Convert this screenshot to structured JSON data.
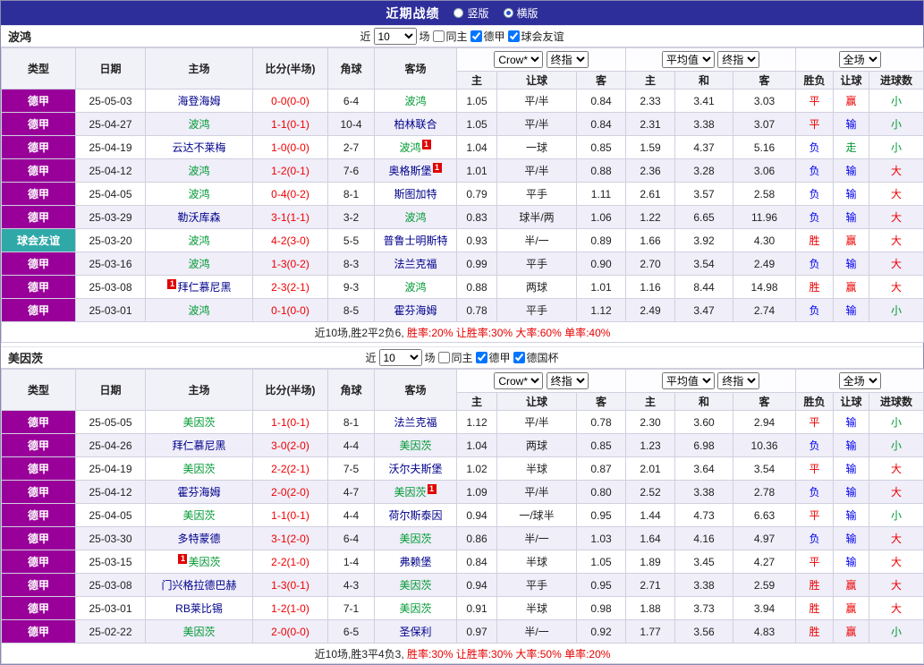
{
  "header": {
    "title": "近期战绩",
    "bar_color": "#2E2E9B",
    "options": [
      {
        "label": "竖版",
        "selected": false
      },
      {
        "label": "横版",
        "selected": true
      }
    ]
  },
  "filter_bar": {
    "near": "近",
    "count": "10",
    "games": "场"
  },
  "columns": [
    "类型",
    "日期",
    "主场",
    "比分(半场)",
    "角球",
    "客场",
    "主",
    "让球",
    "客",
    "主",
    "和",
    "客",
    "胜负",
    "让球",
    "进球数"
  ],
  "dropdowns": {
    "asian": [
      "Crow*",
      "终指"
    ],
    "euro": [
      "平均值",
      "终指"
    ],
    "scope": [
      "全场"
    ]
  },
  "type_colors": {
    "德甲": "#990099",
    "球会友谊": "#2FA8A8"
  },
  "result_colors": {
    "胜": "#EE0000",
    "平": "#EE0000",
    "负": "#0000EE",
    "赢": "#EE0000",
    "输": "#0000EE",
    "走": "#009933",
    "大": "#EE0000",
    "小": "#009933"
  },
  "team_colors": {
    "self": "#009933",
    "opponent": "#00008B"
  },
  "score_color": "#EE0000",
  "tables": [
    {
      "team": "波鸿",
      "filters": [
        {
          "label": "同主",
          "checked": false
        },
        {
          "label": "德甲",
          "checked": true
        },
        {
          "label": "球会友谊",
          "checked": true
        }
      ],
      "rows": [
        {
          "type": "德甲",
          "date": "25-05-03",
          "home": {
            "name": "海登海姆",
            "self": false
          },
          "score": "0-0(0-0)",
          "corners": "6-4",
          "away": {
            "name": "波鸿",
            "self": true
          },
          "asian": [
            "1.05",
            "平/半",
            "0.84"
          ],
          "euro": [
            "2.33",
            "3.41",
            "3.03"
          ],
          "results": [
            "平",
            "赢",
            "小"
          ]
        },
        {
          "type": "德甲",
          "date": "25-04-27",
          "home": {
            "name": "波鸿",
            "self": true
          },
          "score": "1-1(0-1)",
          "corners": "10-4",
          "away": {
            "name": "柏林联合",
            "self": false
          },
          "asian": [
            "1.05",
            "平/半",
            "0.84"
          ],
          "euro": [
            "2.31",
            "3.38",
            "3.07"
          ],
          "results": [
            "平",
            "输",
            "小"
          ]
        },
        {
          "type": "德甲",
          "date": "25-04-19",
          "home": {
            "name": "云达不莱梅",
            "self": false
          },
          "score": "1-0(0-0)",
          "corners": "2-7",
          "away": {
            "name": "波鸿",
            "self": true,
            "card": "1",
            "card_pos": "right"
          },
          "asian": [
            "1.04",
            "一球",
            "0.85"
          ],
          "euro": [
            "1.59",
            "4.37",
            "5.16"
          ],
          "results": [
            "负",
            "走",
            "小"
          ]
        },
        {
          "type": "德甲",
          "date": "25-04-12",
          "home": {
            "name": "波鸿",
            "self": true
          },
          "score": "1-2(0-1)",
          "corners": "7-6",
          "away": {
            "name": "奥格斯堡",
            "self": false,
            "card": "1",
            "card_pos": "right"
          },
          "asian": [
            "1.01",
            "平/半",
            "0.88"
          ],
          "euro": [
            "2.36",
            "3.28",
            "3.06"
          ],
          "results": [
            "负",
            "输",
            "大"
          ]
        },
        {
          "type": "德甲",
          "date": "25-04-05",
          "home": {
            "name": "波鸿",
            "self": true
          },
          "score": "0-4(0-2)",
          "corners": "8-1",
          "away": {
            "name": "斯图加特",
            "self": false
          },
          "asian": [
            "0.79",
            "平手",
            "1.11"
          ],
          "euro": [
            "2.61",
            "3.57",
            "2.58"
          ],
          "results": [
            "负",
            "输",
            "大"
          ]
        },
        {
          "type": "德甲",
          "date": "25-03-29",
          "home": {
            "name": "勒沃库森",
            "self": false
          },
          "score": "3-1(1-1)",
          "corners": "3-2",
          "away": {
            "name": "波鸿",
            "self": true
          },
          "asian": [
            "0.83",
            "球半/两",
            "1.06"
          ],
          "euro": [
            "1.22",
            "6.65",
            "11.96"
          ],
          "results": [
            "负",
            "输",
            "大"
          ]
        },
        {
          "type": "球会友谊",
          "date": "25-03-20",
          "home": {
            "name": "波鸿",
            "self": true
          },
          "score": "4-2(3-0)",
          "corners": "5-5",
          "away": {
            "name": "普鲁士明斯特",
            "self": false
          },
          "asian": [
            "0.93",
            "半/一",
            "0.89"
          ],
          "euro": [
            "1.66",
            "3.92",
            "4.30"
          ],
          "results": [
            "胜",
            "赢",
            "大"
          ]
        },
        {
          "type": "德甲",
          "date": "25-03-16",
          "home": {
            "name": "波鸿",
            "self": true
          },
          "score": "1-3(0-2)",
          "corners": "8-3",
          "away": {
            "name": "法兰克福",
            "self": false
          },
          "asian": [
            "0.99",
            "平手",
            "0.90"
          ],
          "euro": [
            "2.70",
            "3.54",
            "2.49"
          ],
          "results": [
            "负",
            "输",
            "大"
          ]
        },
        {
          "type": "德甲",
          "date": "25-03-08",
          "home": {
            "name": "拜仁慕尼黑",
            "self": false,
            "card": "1",
            "card_pos": "left"
          },
          "score": "2-3(2-1)",
          "corners": "9-3",
          "away": {
            "name": "波鸿",
            "self": true
          },
          "asian": [
            "0.88",
            "两球",
            "1.01"
          ],
          "euro": [
            "1.16",
            "8.44",
            "14.98"
          ],
          "results": [
            "胜",
            "赢",
            "大"
          ]
        },
        {
          "type": "德甲",
          "date": "25-03-01",
          "home": {
            "name": "波鸿",
            "self": true
          },
          "score": "0-1(0-0)",
          "corners": "8-5",
          "away": {
            "name": "霍芬海姆",
            "self": false
          },
          "asian": [
            "0.78",
            "平手",
            "1.12"
          ],
          "euro": [
            "2.49",
            "3.47",
            "2.74"
          ],
          "results": [
            "负",
            "输",
            "小"
          ]
        }
      ],
      "summary": {
        "prefix": "近10场,胜2平2负6, ",
        "stats": "胜率:20% 让胜率:30% 大率:60% 单率:40%"
      }
    },
    {
      "team": "美因茨",
      "filters": [
        {
          "label": "同主",
          "checked": false
        },
        {
          "label": "德甲",
          "checked": true
        },
        {
          "label": "德国杯",
          "checked": true
        }
      ],
      "rows": [
        {
          "type": "德甲",
          "date": "25-05-05",
          "home": {
            "name": "美因茨",
            "self": true
          },
          "score": "1-1(0-1)",
          "corners": "8-1",
          "away": {
            "name": "法兰克福",
            "self": false
          },
          "asian": [
            "1.12",
            "平/半",
            "0.78"
          ],
          "euro": [
            "2.30",
            "3.60",
            "2.94"
          ],
          "results": [
            "平",
            "输",
            "小"
          ]
        },
        {
          "type": "德甲",
          "date": "25-04-26",
          "home": {
            "name": "拜仁慕尼黑",
            "self": false
          },
          "score": "3-0(2-0)",
          "corners": "4-4",
          "away": {
            "name": "美因茨",
            "self": true
          },
          "asian": [
            "1.04",
            "两球",
            "0.85"
          ],
          "euro": [
            "1.23",
            "6.98",
            "10.36"
          ],
          "results": [
            "负",
            "输",
            "小"
          ]
        },
        {
          "type": "德甲",
          "date": "25-04-19",
          "home": {
            "name": "美因茨",
            "self": true
          },
          "score": "2-2(2-1)",
          "corners": "7-5",
          "away": {
            "name": "沃尔夫斯堡",
            "self": false
          },
          "asian": [
            "1.02",
            "半球",
            "0.87"
          ],
          "euro": [
            "2.01",
            "3.64",
            "3.54"
          ],
          "results": [
            "平",
            "输",
            "大"
          ]
        },
        {
          "type": "德甲",
          "date": "25-04-12",
          "home": {
            "name": "霍芬海姆",
            "self": false
          },
          "score": "2-0(2-0)",
          "corners": "4-7",
          "away": {
            "name": "美因茨",
            "self": true,
            "card": "1",
            "card_pos": "right"
          },
          "asian": [
            "1.09",
            "平/半",
            "0.80"
          ],
          "euro": [
            "2.52",
            "3.38",
            "2.78"
          ],
          "results": [
            "负",
            "输",
            "大"
          ]
        },
        {
          "type": "德甲",
          "date": "25-04-05",
          "home": {
            "name": "美因茨",
            "self": true
          },
          "score": "1-1(0-1)",
          "corners": "4-4",
          "away": {
            "name": "荷尔斯泰因",
            "self": false
          },
          "asian": [
            "0.94",
            "一/球半",
            "0.95"
          ],
          "euro": [
            "1.44",
            "4.73",
            "6.63"
          ],
          "results": [
            "平",
            "输",
            "小"
          ]
        },
        {
          "type": "德甲",
          "date": "25-03-30",
          "home": {
            "name": "多特蒙德",
            "self": false
          },
          "score": "3-1(2-0)",
          "corners": "6-4",
          "away": {
            "name": "美因茨",
            "self": true
          },
          "asian": [
            "0.86",
            "半/一",
            "1.03"
          ],
          "euro": [
            "1.64",
            "4.16",
            "4.97"
          ],
          "results": [
            "负",
            "输",
            "大"
          ]
        },
        {
          "type": "德甲",
          "date": "25-03-15",
          "home": {
            "name": "美因茨",
            "self": true,
            "card": "1",
            "card_pos": "left"
          },
          "score": "2-2(1-0)",
          "corners": "1-4",
          "away": {
            "name": "弗赖堡",
            "self": false
          },
          "asian": [
            "0.84",
            "半球",
            "1.05"
          ],
          "euro": [
            "1.89",
            "3.45",
            "4.27"
          ],
          "results": [
            "平",
            "输",
            "大"
          ]
        },
        {
          "type": "德甲",
          "date": "25-03-08",
          "home": {
            "name": "门兴格拉德巴赫",
            "self": false
          },
          "score": "1-3(0-1)",
          "corners": "4-3",
          "away": {
            "name": "美因茨",
            "self": true
          },
          "asian": [
            "0.94",
            "平手",
            "0.95"
          ],
          "euro": [
            "2.71",
            "3.38",
            "2.59"
          ],
          "results": [
            "胜",
            "赢",
            "大"
          ]
        },
        {
          "type": "德甲",
          "date": "25-03-01",
          "home": {
            "name": "RB莱比锡",
            "self": false
          },
          "score": "1-2(1-0)",
          "corners": "7-1",
          "away": {
            "name": "美因茨",
            "self": true
          },
          "asian": [
            "0.91",
            "半球",
            "0.98"
          ],
          "euro": [
            "1.88",
            "3.73",
            "3.94"
          ],
          "results": [
            "胜",
            "赢",
            "大"
          ]
        },
        {
          "type": "德甲",
          "date": "25-02-22",
          "home": {
            "name": "美因茨",
            "self": true
          },
          "score": "2-0(0-0)",
          "corners": "6-5",
          "away": {
            "name": "圣保利",
            "self": false
          },
          "asian": [
            "0.97",
            "半/一",
            "0.92"
          ],
          "euro": [
            "1.77",
            "3.56",
            "4.83"
          ],
          "results": [
            "胜",
            "赢",
            "小"
          ]
        }
      ],
      "summary": {
        "prefix": "近10场,胜3平4负3, ",
        "stats": "胜率:30% 让胜率:30% 大率:50% 单率:20%"
      }
    }
  ]
}
